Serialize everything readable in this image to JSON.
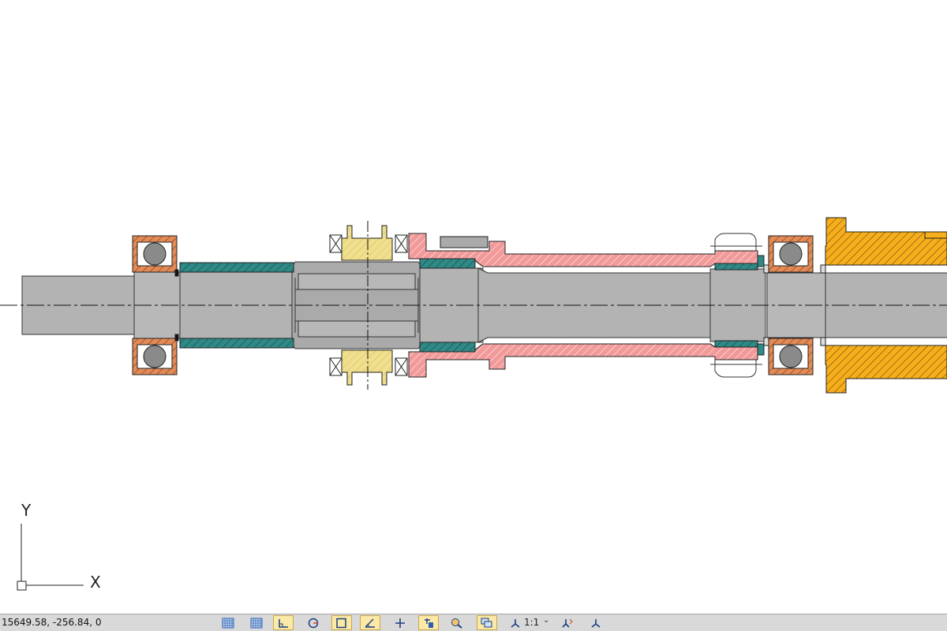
{
  "canvas": {
    "ucs": {
      "x_label": "X",
      "y_label": "Y"
    }
  },
  "statusbar": {
    "coordinates": "15649.58, -256.84, 0",
    "annotation_scale": "1:1",
    "buttons": [
      {
        "name": "grid-display-button",
        "icon": "grid-icon",
        "on": false
      },
      {
        "name": "snap-mode-button",
        "icon": "snap-grid-icon",
        "on": false
      },
      {
        "name": "ortho-mode-button",
        "icon": "ortho-icon",
        "on": true
      },
      {
        "name": "polar-tracking-button",
        "icon": "polar-icon",
        "on": false
      },
      {
        "name": "object-snap-button",
        "icon": "osnap-icon",
        "on": true
      },
      {
        "name": "dynamic-ucs-button",
        "icon": "dynamic-ucs-icon",
        "on": true
      },
      {
        "name": "object-snap-tracking-button",
        "icon": "tracking-icon",
        "on": false
      },
      {
        "name": "lineweight-button",
        "icon": "lineweight-icon",
        "on": true
      },
      {
        "name": "transparency-button",
        "icon": "transparency-icon",
        "on": false
      },
      {
        "name": "selection-cycling-button",
        "icon": "selection-cycling-icon",
        "on": true
      }
    ],
    "colors": {
      "background": "#d9d9d9",
      "active": "#fbe9a8",
      "active_border": "#c9a64b"
    }
  },
  "drawing_colors": {
    "shaft": "#b3b3b3",
    "bearing_ring": "#e58a55",
    "ball": "#8a8a8a",
    "bushing": "#2e8a87",
    "sprocket": "#f0df8c",
    "housing": "#f29a9a",
    "coupling": "#f7ae1a"
  }
}
